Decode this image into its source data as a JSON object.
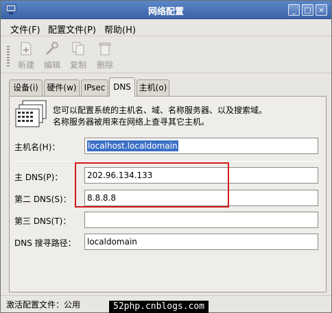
{
  "window": {
    "title": "网络配置"
  },
  "titlebar_buttons": {
    "minimize": "_",
    "maximize": "□",
    "close": "×"
  },
  "menu": {
    "file": "文件(F)",
    "profile": "配置文件(P)",
    "help": "帮助(H)"
  },
  "toolbar": {
    "new": "新建",
    "edit": "编辑",
    "copy": "复制",
    "delete": "删除"
  },
  "tabs": [
    {
      "label": "设备(i)"
    },
    {
      "label": "硬件(w)"
    },
    {
      "label": "IPsec"
    },
    {
      "label": "DNS",
      "active": true
    },
    {
      "label": "主机(o)"
    }
  ],
  "description": {
    "line1": "您可以配置系统的主机名、域、名称服务器、以及搜索域。",
    "line2": "名称服务器被用来在网络上查寻其它主机。"
  },
  "form": {
    "hostname_label": "主机名(H)：",
    "hostname_value": "localhost.localdomain",
    "dns1_label": "主 DNS(P)：",
    "dns1_value": "202.96.134.133",
    "dns2_label": "第二 DNS(S)：",
    "dns2_value": "8.8.8.8",
    "dns3_label": "第三 DNS(T)：",
    "dns3_value": "",
    "search_label": "DNS 搜寻路径：",
    "search_value": "localdomain"
  },
  "statusbar": {
    "text": "激活配置文件：公用"
  },
  "watermark": {
    "text": "52php.cnblogs.com"
  },
  "colors": {
    "titlebar": "#4a72b4",
    "highlight_box": "#d11a1a",
    "selection": "#3b6fc6"
  }
}
